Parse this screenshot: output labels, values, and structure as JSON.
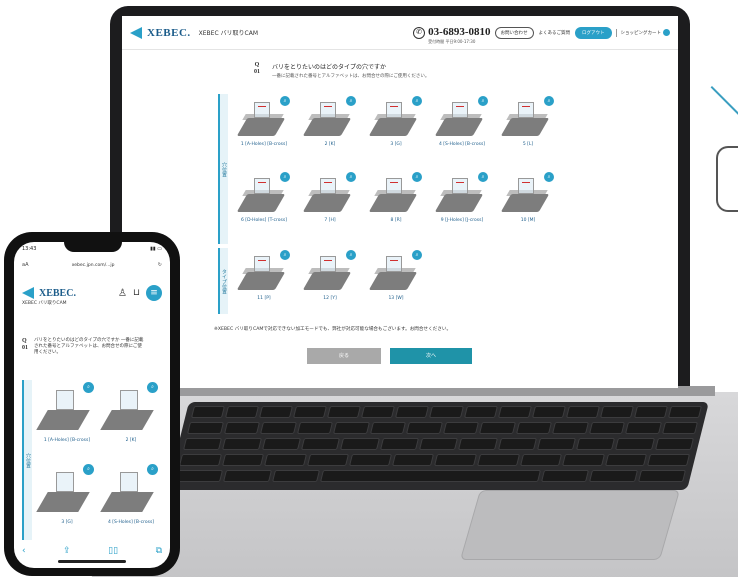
{
  "laptop": {
    "header": {
      "logo_text": "XEBEC.",
      "app_name": "XEBEC バリ取りCAM",
      "phone_number": "03-6893-0810",
      "phone_hours": "受付時間 平日9:00-17:30",
      "contact_button": "お問い合わせ",
      "faq_link": "よくあるご質問",
      "login_button": "ログアウト",
      "cart_link": "ショッピングカート"
    },
    "question": {
      "number_label": "Q\n01",
      "title": "バリをとりたいのはどのタイプの穴ですか",
      "subtitle": "一番に記載された番号とアルファベットは、お問合せの際にご使用ください。"
    },
    "categories": [
      "穴位置",
      "タイプ位置"
    ],
    "items": [
      {
        "caption": "1 [A-Holes] [B-cross]"
      },
      {
        "caption": "2 [K]"
      },
      {
        "caption": "3 [G]"
      },
      {
        "caption": "4 [S-Holes] [B-cross]"
      },
      {
        "caption": "5 [L]"
      },
      {
        "caption": "6 [D-Holes] [T-cross]"
      },
      {
        "caption": "7 [H]"
      },
      {
        "caption": "8 [R]"
      },
      {
        "caption": "9 [J-Holes] [J-cross]"
      },
      {
        "caption": "10 [M]"
      },
      {
        "caption": "11 [P]"
      },
      {
        "caption": "12 [Y]"
      },
      {
        "caption": "13 [W]"
      }
    ],
    "note": "※XEBEC バリ取りCAMで対応できない加工モードでも、弊社が対応可能な場合もございます。お問合せください。",
    "back_button": "戻る",
    "next_button": "次へ"
  },
  "phone": {
    "status_time": "13:43",
    "url": "xebec.jpn.com/...jp",
    "logo_text": "XEBEC.",
    "app_name": "XEBEC バリ取りCAM",
    "question": {
      "number_label": "Q\n01",
      "text": "バリをとりたいのはどのタイプの穴ですか 一番に記載された番号とアルファベットは、お問合せの際にご使用ください。"
    },
    "category": "穴位置",
    "items": [
      {
        "caption": "1 [A-Holes] [B-cross]"
      },
      {
        "caption": "2 [K]"
      },
      {
        "caption": "3 [G]"
      },
      {
        "caption": "4 [S-Holes] [B-cross]"
      }
    ]
  },
  "colors": {
    "accent": "#2aa0c8",
    "next_button": "#1f93a8",
    "back_button": "#a9a9a9",
    "logo": "#1b5c8a"
  }
}
